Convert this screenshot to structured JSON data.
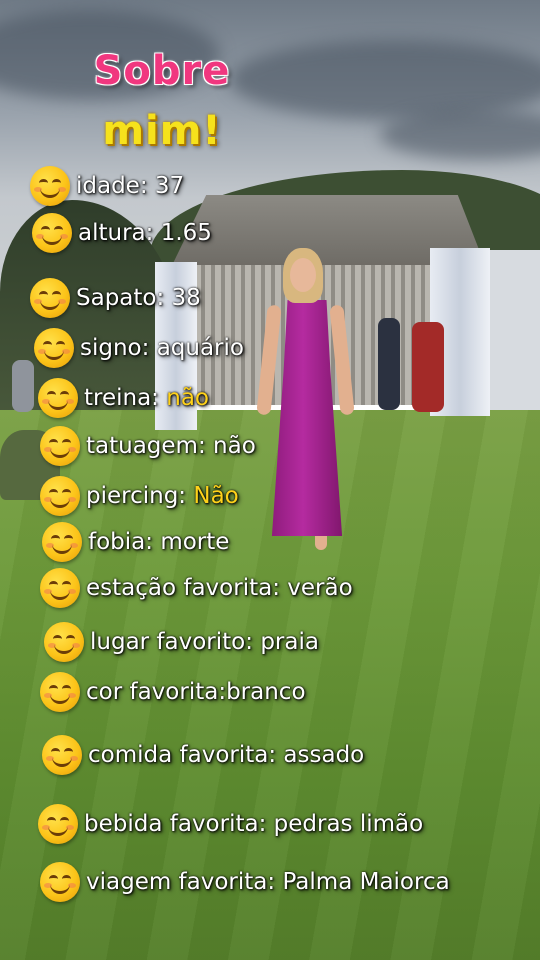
{
  "title": {
    "line1": "Sobre",
    "line2": "mim!"
  },
  "icon": "smiling-face-emoji",
  "colors": {
    "title_line1": "#f0377f",
    "title_line2": "#f6e21c",
    "text": "#ffffff",
    "highlight": "#ffd21a"
  },
  "items": [
    {
      "label": "idade:",
      "value": "37"
    },
    {
      "label": "altura:",
      "value": "1.65"
    },
    {
      "label": "Sapato:",
      "value": "38"
    },
    {
      "label": "signo:",
      "value": "aquário"
    },
    {
      "label": "treina:",
      "value": "não"
    },
    {
      "label": "tatuagem:",
      "value": "não"
    },
    {
      "label": "piercing:",
      "value": "Não"
    },
    {
      "label": "fobia:",
      "value": "morte"
    },
    {
      "label": "estação favorita:",
      "value": "verão"
    },
    {
      "label": "lugar favorito:",
      "value": "praia"
    },
    {
      "label": "cor favorita:",
      "value": "branco"
    },
    {
      "label": "comida favorita:",
      "value": "assado"
    },
    {
      "label": "bebida favorita:",
      "value": "pedras limão"
    },
    {
      "label": "viagem  favorita:",
      "value": "Palma Maiorca"
    }
  ]
}
